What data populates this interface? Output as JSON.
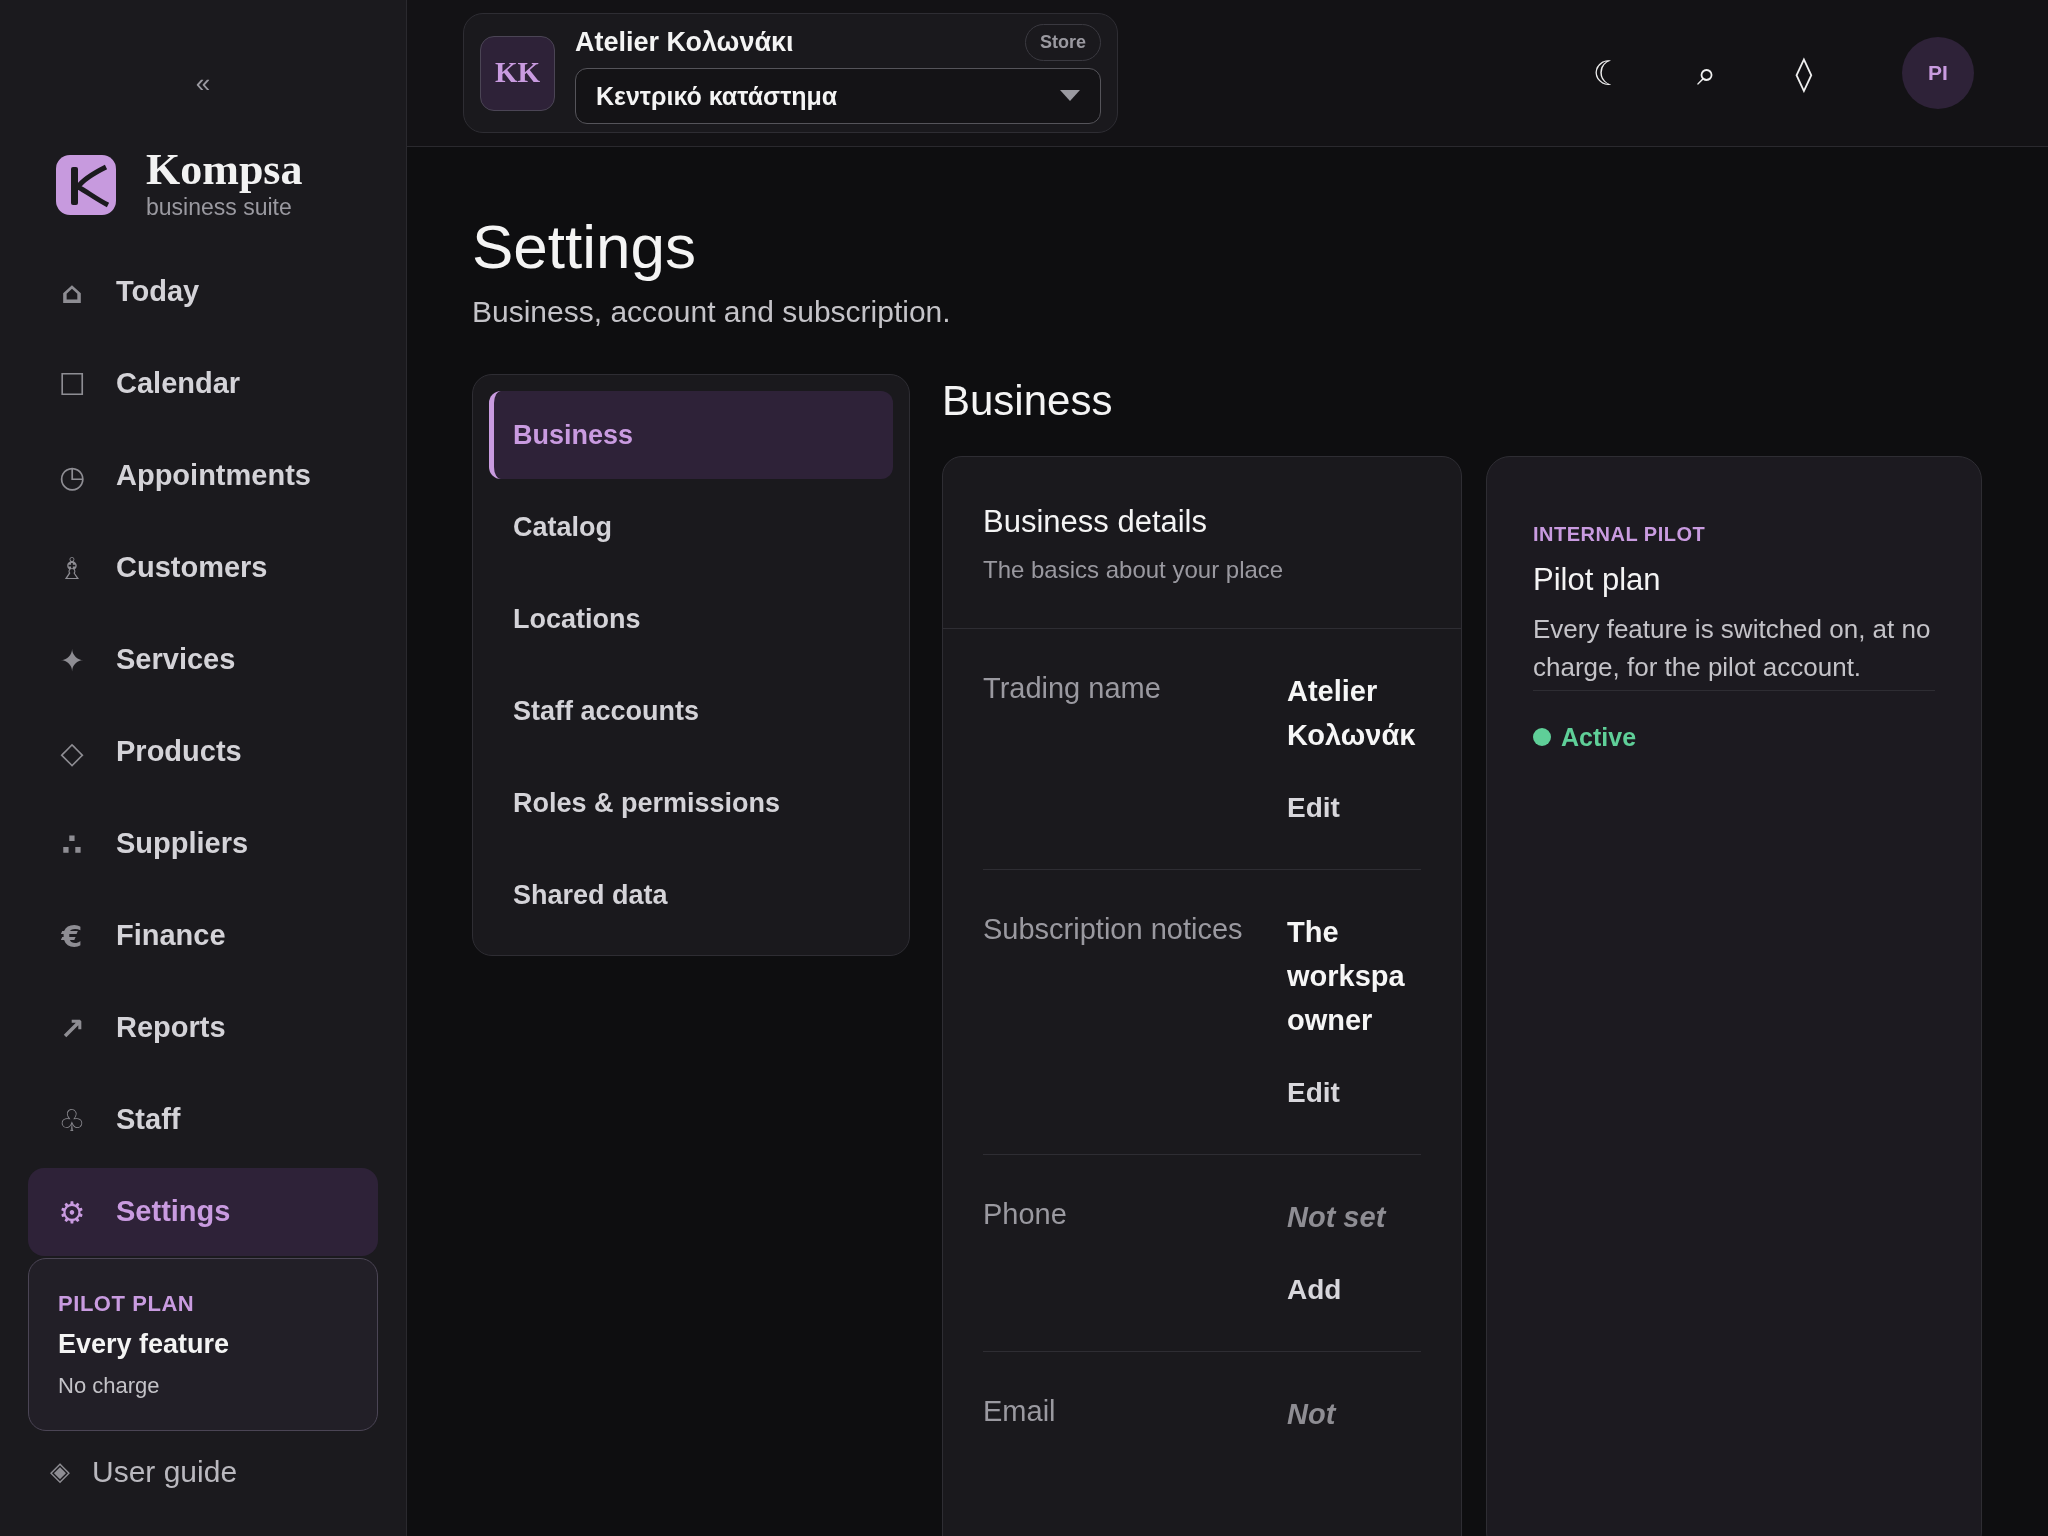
{
  "sidebar": {
    "collapse": "«",
    "brand": {
      "name": "Kompsa",
      "tagline": "business suite"
    },
    "nav": [
      {
        "icon": "⌂",
        "label": "Today",
        "selected": false
      },
      {
        "icon": "☐",
        "label": "Calendar",
        "selected": false
      },
      {
        "icon": "◷",
        "label": "Appointments",
        "selected": false
      },
      {
        "icon": "♗",
        "label": "Customers",
        "selected": false
      },
      {
        "icon": "✦",
        "label": "Services",
        "selected": false
      },
      {
        "icon": "◇",
        "label": "Products",
        "selected": false
      },
      {
        "icon": "∴",
        "label": "Suppliers",
        "selected": false
      },
      {
        "icon": "€",
        "label": "Finance",
        "selected": false
      },
      {
        "icon": "↗",
        "label": "Reports",
        "selected": false
      },
      {
        "icon": "♧",
        "label": "Staff",
        "selected": false
      },
      {
        "icon": "⚙",
        "label": "Settings",
        "selected": true
      }
    ],
    "plan_card": {
      "eyebrow": "PILOT PLAN",
      "title": "Every feature",
      "note": "No charge"
    },
    "footer_link": {
      "icon": "◈",
      "label": "User guide"
    }
  },
  "header": {
    "store": {
      "initials": "KK",
      "name": "Atelier Κολωνάκι",
      "badge": "Store",
      "location": "Κεντρικό κατάστημα"
    },
    "actions": [
      "☾",
      "⌕",
      "◊"
    ],
    "avatar": "PI"
  },
  "page": {
    "title": "Settings",
    "subtitle": "Business, account and subscription."
  },
  "settings_nav": [
    {
      "label": "Business",
      "selected": true
    },
    {
      "label": "Catalog",
      "selected": false
    },
    {
      "label": "Locations",
      "selected": false
    },
    {
      "label": "Staff accounts",
      "selected": false
    },
    {
      "label": "Roles & permissions",
      "selected": false
    },
    {
      "label": "Shared data",
      "selected": false
    }
  ],
  "section_title": "Business",
  "details": {
    "title": "Business details",
    "subtitle": "The basics about your place",
    "rows": [
      {
        "label": "Trading name",
        "value": "Atelier Κολωνάκ",
        "is_set": true,
        "action": "Edit"
      },
      {
        "label": "Subscription notices",
        "value": "The workspa owner",
        "is_set": true,
        "action": "Edit"
      },
      {
        "label": "Phone",
        "value": "Not set",
        "is_set": false,
        "action": "Add"
      },
      {
        "label": "Email",
        "value": "Not",
        "is_set": false
      }
    ]
  },
  "plan": {
    "eyebrow": "INTERNAL PILOT",
    "title": "Pilot plan",
    "description": "Every feature is switched on, at no charge, for the pilot account.",
    "status": {
      "label": "Active",
      "color": "#5fcf98"
    }
  }
}
